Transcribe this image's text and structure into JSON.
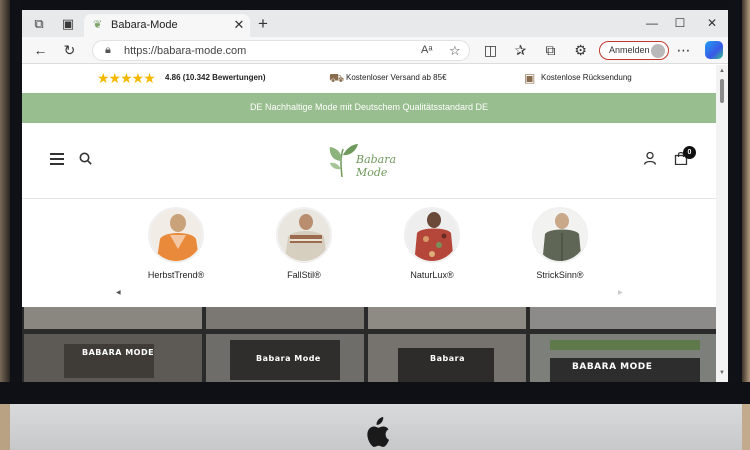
{
  "browser": {
    "tab_title": "Babara-Mode",
    "url": "https://babara-mode.com",
    "signin_label": "Anmelden",
    "tab_close": "✕",
    "new_tab": "+"
  },
  "trust_bar": {
    "stars": "★★★★★",
    "rating": "4.86 (10.342 Bewertungen)",
    "shipping": "Kostenloser Versand ab 85€",
    "returns": "Kostenlose Rücksendung"
  },
  "banner": {
    "text": "DE Nachhaltige Mode mit Deutschem Qualitätsstandard DE"
  },
  "header": {
    "logo_text": "Babara Mode",
    "cart_count": "0"
  },
  "categories": [
    {
      "label": "HerbstTrend®",
      "color": "#e98a3b"
    },
    {
      "label": "FallStil®",
      "color": "#d6cfc0"
    },
    {
      "label": "NaturLux®",
      "color": "#b5473a"
    },
    {
      "label": "StrickSinn®",
      "color": "#5f6656"
    }
  ],
  "gallery": {
    "signs": [
      "BABARA MODE",
      "Babara Mode",
      "Babara",
      "BABARA MODE"
    ]
  },
  "colors": {
    "banner": "#98bd8e",
    "accent_green": "#6f9a5c",
    "star": "#f5b800",
    "signin_border": "#c0392b"
  },
  "icons": {
    "shipping": "truck-icon",
    "returns": "box-icon",
    "menu": "hamburger-icon",
    "search": "search-icon",
    "user": "user-icon",
    "cart": "bag-icon"
  }
}
